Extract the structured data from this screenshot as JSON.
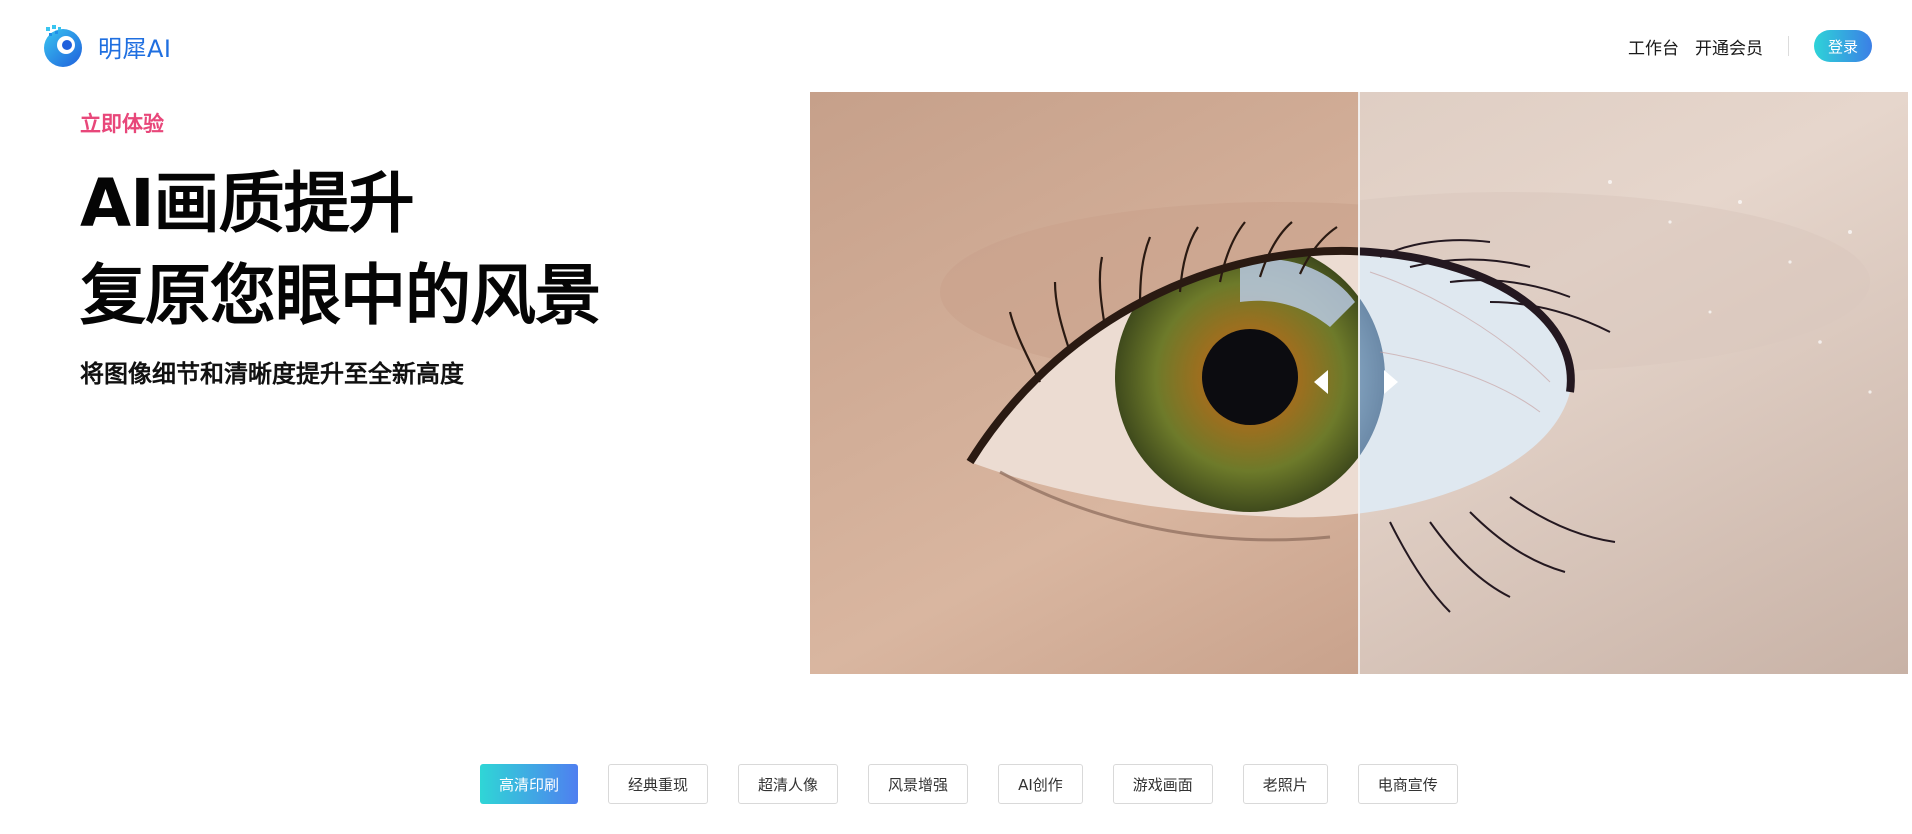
{
  "brand": {
    "name": "明犀AI",
    "logo_icon": "rhino-logo-icon",
    "accent": "#1f6fe0"
  },
  "nav": {
    "workbench": "工作台",
    "membership": "开通会员",
    "login": "登录"
  },
  "hero": {
    "eyebrow": "立即体验",
    "title_line1": "AI画质提升",
    "title_line2": "复原您眼中的风景",
    "subtitle": "将图像细节和清晰度提升至全新高度",
    "eyebrow_color": "#e8477a"
  },
  "compare": {
    "image": "before-after-eye-photo",
    "left_handle_icon": "triangle-left-icon",
    "right_handle_icon": "triangle-right-icon"
  },
  "tabs": [
    {
      "label": "高清印刷",
      "active": true
    },
    {
      "label": "经典重现",
      "active": false
    },
    {
      "label": "超清人像",
      "active": false
    },
    {
      "label": "风景增强",
      "active": false
    },
    {
      "label": "AI创作",
      "active": false
    },
    {
      "label": "游戏画面",
      "active": false
    },
    {
      "label": "老照片",
      "active": false
    },
    {
      "label": "电商宣传",
      "active": false
    }
  ]
}
